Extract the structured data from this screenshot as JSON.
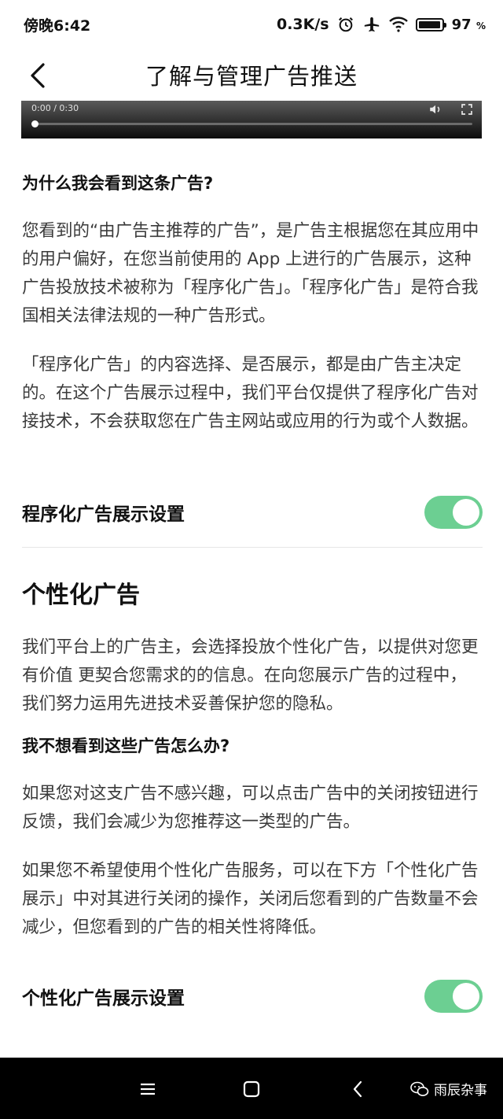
{
  "status": {
    "time": "傍晚6:42",
    "speed": "0.3K/s",
    "battery_pct": "97",
    "battery_unit": "%",
    "battery_level": 0.97,
    "icons": [
      "alarm-icon",
      "airplane-icon",
      "wifi-icon",
      "battery-icon"
    ]
  },
  "nav": {
    "title": "了解与管理广告推送",
    "back_icon": "back-arrow-icon"
  },
  "video": {
    "time": "0:00 / 0:30",
    "progress": 0.0,
    "icons": [
      "volume-icon",
      "fullscreen-icon"
    ]
  },
  "section1": {
    "question": "为什么我会看到这条广告?",
    "para1": "您看到的“由广告主推荐的广告”，是广告主根据您在其应用中的用户偏好，在您当前使用的 App 上进行的广告展示，这种广告投放技术被称为「程序化广告」。「程序化广告」是符合我国相关法律法规的一种广告形式。",
    "para2": "「程序化广告」的内容选择、是否展示，都是由广告主决定的。在这个广告展示过程中，我们平台仅提供了程序化广告对接技术，不会获取您在广告主网站或应用的行为或个人数据。",
    "setting_label": "程序化广告展示设置",
    "setting_on": true
  },
  "section2": {
    "title": "个性化广告",
    "para1": "我们平台上的广告主，会选择投放个性化广告，以提供对您更有价值 更契合您需求的的信息。在向您展示广告的过程中，我们努力运用先进技术妥善保护您的隐私。",
    "question": "我不想看到这些广告怎么办?",
    "para2": "如果您对这支广告不感兴趣，可以点击广告中的关闭按钮进行反馈，我们会减少为您推荐这一类型的广告。",
    "para3": "如果您不希望使用个性化广告服务，可以在下方「个性化广告展示」中对其进行关闭的操作，关闭后您看到的广告数量不会减少，但您看到的广告的相关性将降低。",
    "setting_label": "个性化广告展示设置",
    "setting_on": true
  },
  "system_nav": {
    "icons": [
      "menu-icon",
      "home-icon",
      "back-icon"
    ],
    "watermark": "雨辰杂事"
  },
  "colors": {
    "toggle_on": "#6ccf92",
    "background": "#ffffff",
    "nav_bar": "#000000"
  }
}
